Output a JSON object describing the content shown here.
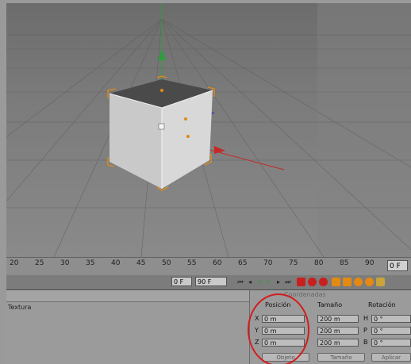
{
  "timeline": {
    "ticks": [
      "20",
      "25",
      "30",
      "35",
      "40",
      "45",
      "50",
      "55",
      "60",
      "65",
      "70",
      "75",
      "80",
      "85",
      "90"
    ],
    "current_frame": "0 F"
  },
  "transport": {
    "start_frame": "0 F",
    "end_frame": "90 F"
  },
  "material_panel": {
    "column_label": "Textura"
  },
  "coordinates": {
    "title": "Coordenadas",
    "headers": {
      "position": "Posición",
      "size": "Tamaño",
      "rotation": "Rotación"
    },
    "axes": [
      "X",
      "Y",
      "Z"
    ],
    "rot_axes": [
      "H",
      "P",
      "B"
    ],
    "position_values": [
      "0 m",
      "0 m",
      "0 m"
    ],
    "size_values": [
      "200 m",
      "200 m",
      "200 m"
    ],
    "rotation_values": [
      "0 °",
      "0 °",
      "0 °"
    ],
    "mode_select": "Objeto",
    "size_mode_select": "Tamaño",
    "apply_button": "Aplicar"
  },
  "colors": {
    "annotation_circle": "#d21d1d",
    "axis_x": "#c62828",
    "axis_y": "#2e9e3b",
    "axis_z": "#2a3bb0",
    "selection": "#e38a12"
  },
  "icons": [
    "go-to-start-icon",
    "prev-key-icon",
    "play-back-icon",
    "play-forward-icon",
    "next-key-icon",
    "go-to-end-icon",
    "record-icon",
    "autokey-icon",
    "key-help-icon",
    "move-key-icon",
    "scale-key-icon",
    "rotate-key-icon",
    "param-key-icon",
    "grid-key-icon"
  ]
}
